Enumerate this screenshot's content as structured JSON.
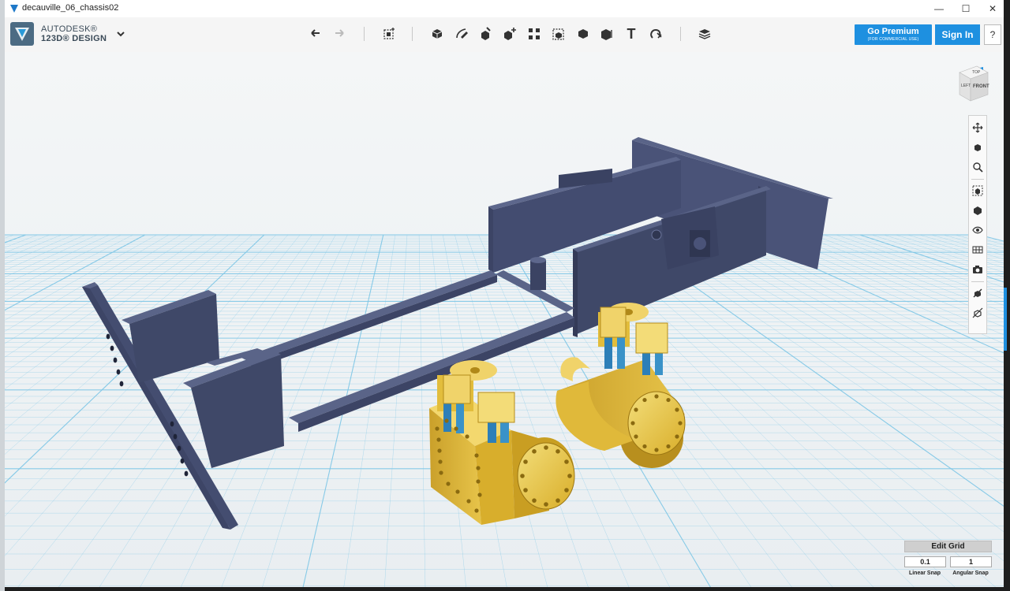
{
  "window": {
    "title": "decauville_06_chassis02",
    "controls": {
      "minimize": "—",
      "maximize": "☐",
      "close": "✕"
    }
  },
  "brand": {
    "line1": "AUTODESK®",
    "line2": "123D® DESIGN"
  },
  "toolbar": {
    "tools": [
      "undo-icon",
      "redo-icon",
      "transform-icon",
      "primitives-icon",
      "sketch-icon",
      "construct-icon",
      "modify-icon",
      "pattern-icon",
      "grouping-icon",
      "combine-icon",
      "measure-icon",
      "text-icon",
      "snap-icon",
      "material-icon"
    ],
    "text_tool_glyph": "T"
  },
  "premium": {
    "label": "Go Premium",
    "sublabel": "(FOR COMMERCIAL USE)"
  },
  "signin": {
    "label": "Sign In"
  },
  "help": {
    "label": "?"
  },
  "viewcube": {
    "top_label": "TOP",
    "left_label": "LEFT",
    "front_label": "FRONT"
  },
  "navbar": {
    "tools": [
      "pan-icon",
      "orbit-icon",
      "zoom-icon",
      "fit-icon",
      "view-solid-icon",
      "visibility-icon",
      "materials-icon",
      "screenshot-icon",
      "snap-grid-icon",
      "perspective-icon"
    ]
  },
  "grid": {
    "edit_label": "Edit Grid",
    "linear_snap_value": "0.1",
    "angular_snap_value": "1",
    "linear_snap_label": "Linear Snap",
    "angular_snap_label": "Angular Snap"
  },
  "colors": {
    "accent": "#1e90e0",
    "chassis": "#3d4566",
    "brass": "#e8c43a",
    "valve_blue": "#2d7fb8",
    "grid_line": "#7cc5e6",
    "grid_bg": "#eef3f5"
  }
}
